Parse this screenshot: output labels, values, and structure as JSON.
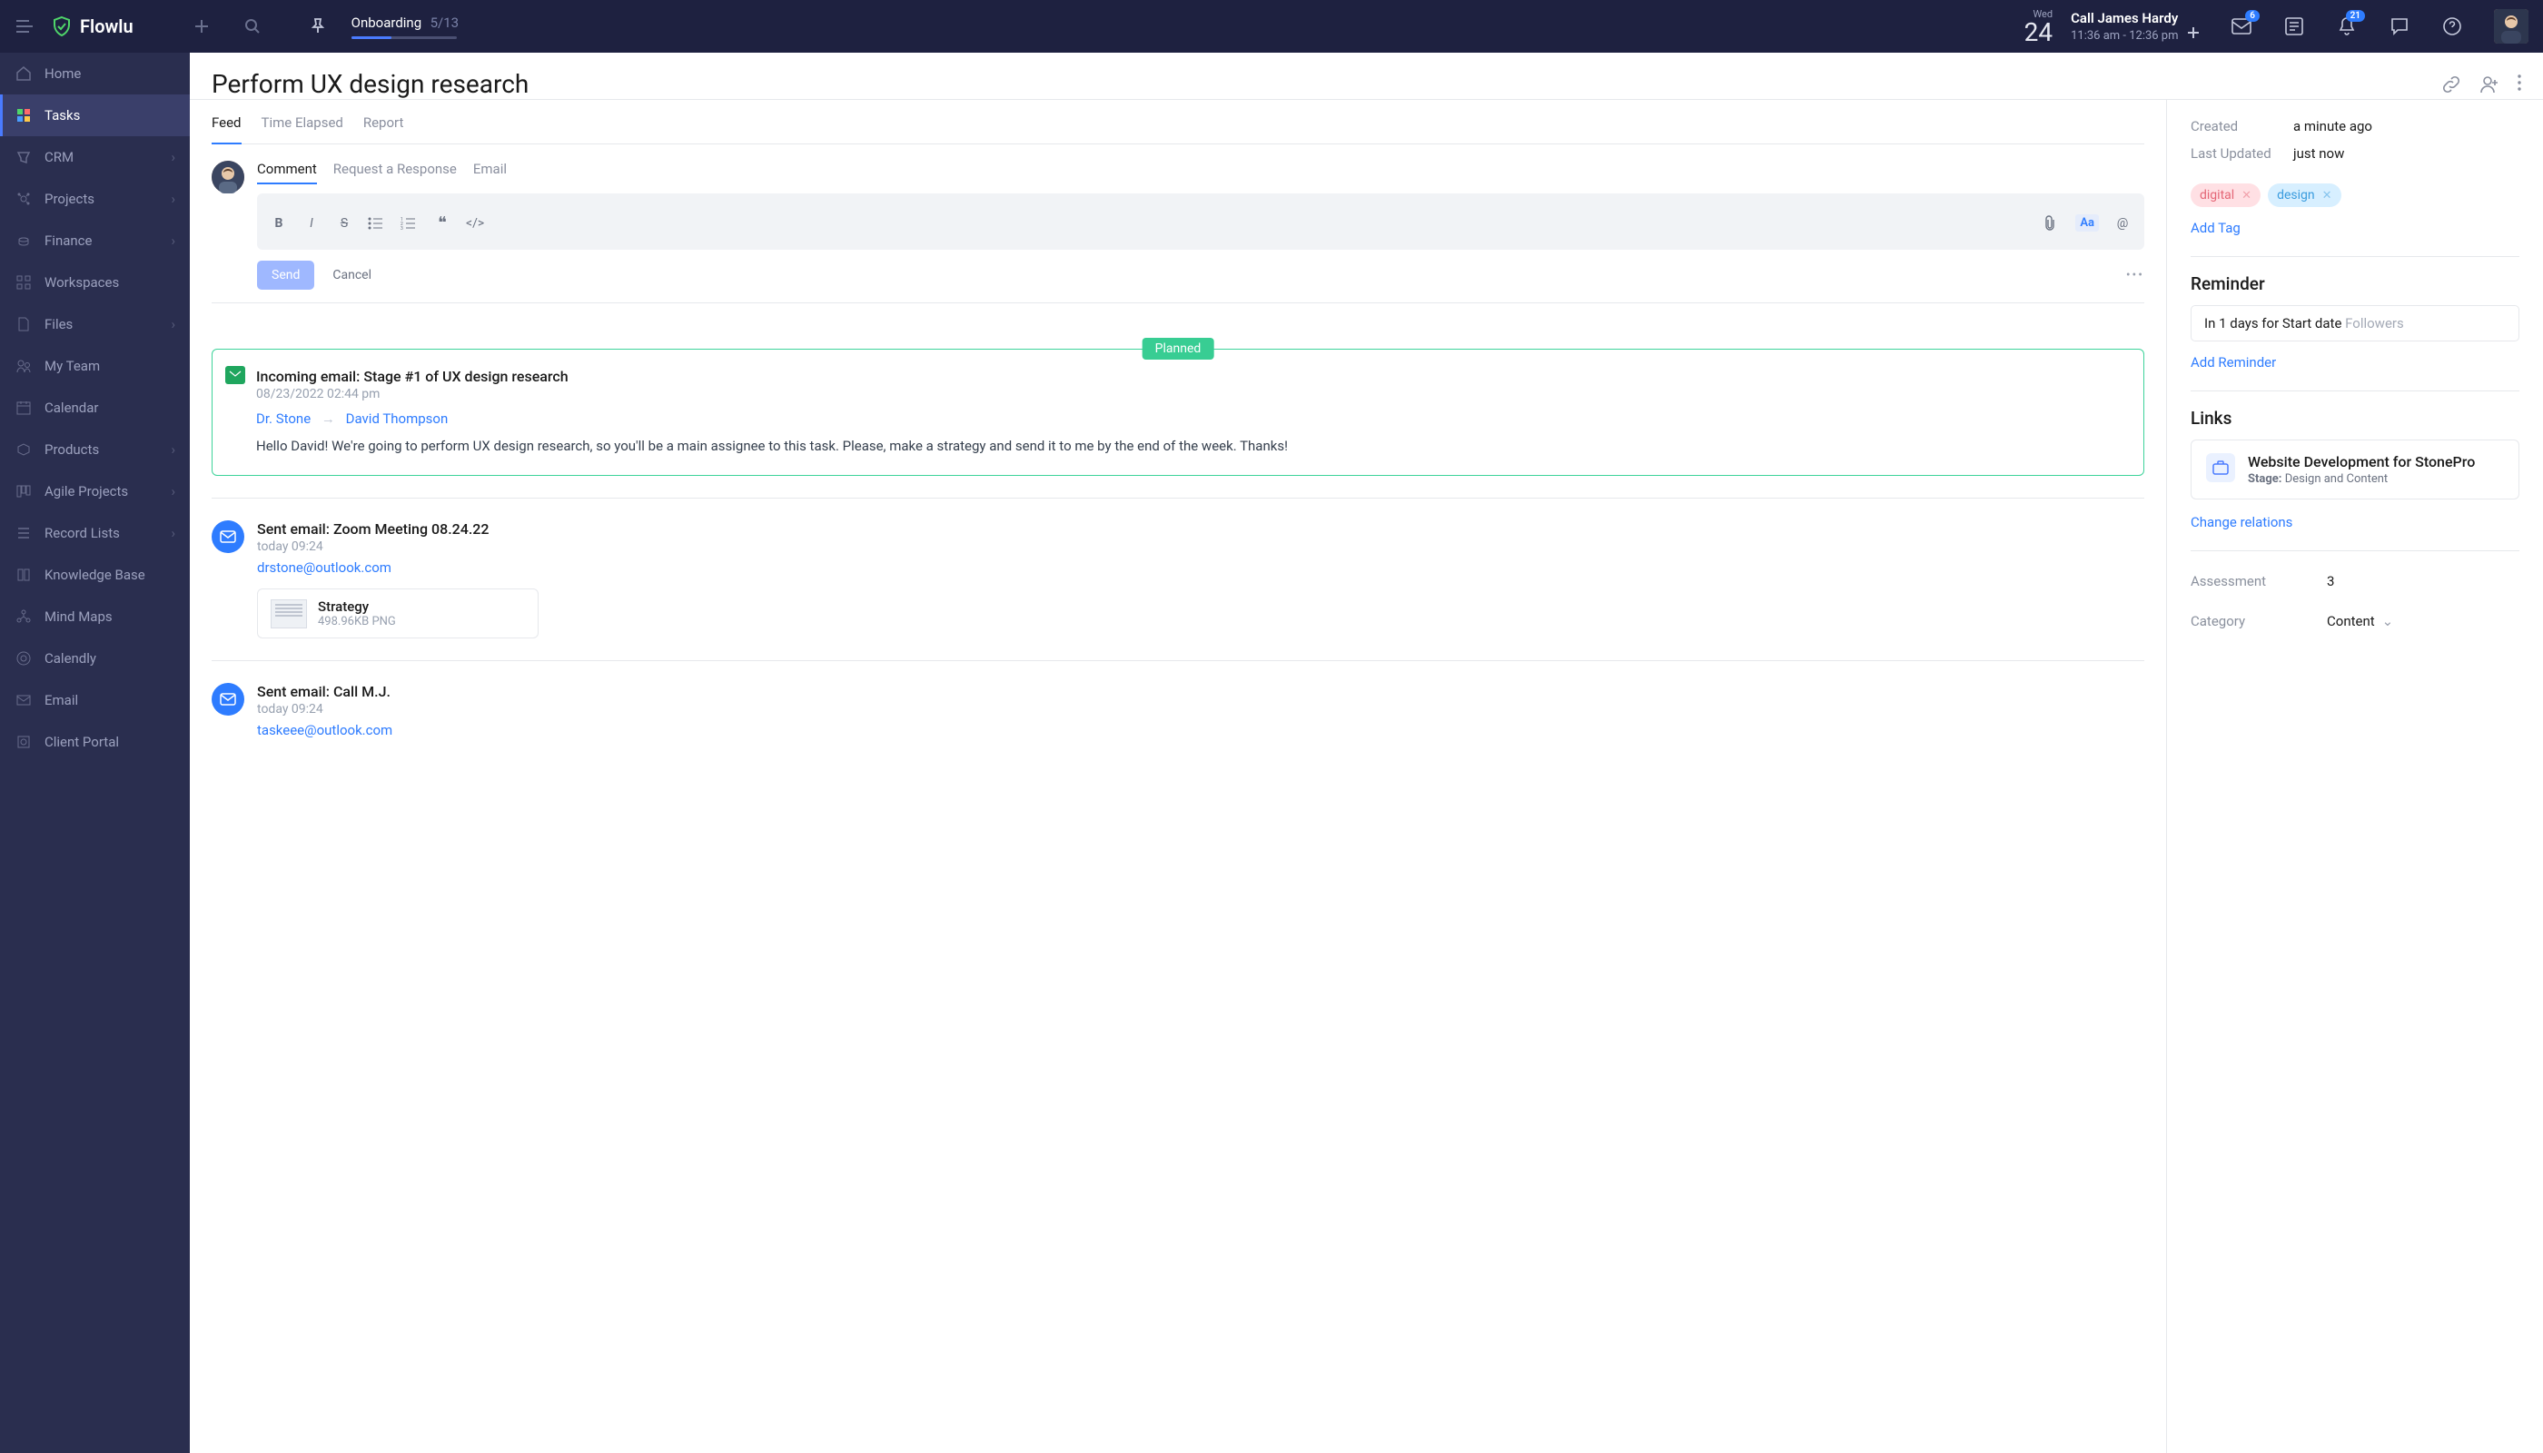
{
  "brand": "Flowlu",
  "onboarding": {
    "label": "Onboarding",
    "count": "5/13",
    "progress_pct": 38
  },
  "top_date": {
    "weekday": "Wed",
    "day": "24"
  },
  "top_event": {
    "title": "Call James Hardy",
    "time": "11:36 am - 12:36 pm"
  },
  "badges": {
    "mail": "6",
    "bell": "21"
  },
  "sidebar": [
    {
      "label": "Home",
      "chev": false
    },
    {
      "label": "Tasks",
      "chev": false
    },
    {
      "label": "CRM",
      "chev": true
    },
    {
      "label": "Projects",
      "chev": true
    },
    {
      "label": "Finance",
      "chev": true
    },
    {
      "label": "Workspaces",
      "chev": false
    },
    {
      "label": "Files",
      "chev": true
    },
    {
      "label": "My Team",
      "chev": false
    },
    {
      "label": "Calendar",
      "chev": false
    },
    {
      "label": "Products",
      "chev": true
    },
    {
      "label": "Agile Projects",
      "chev": true
    },
    {
      "label": "Record Lists",
      "chev": true
    },
    {
      "label": "Knowledge Base",
      "chev": false
    },
    {
      "label": "Mind Maps",
      "chev": false
    },
    {
      "label": "Calendly",
      "chev": false
    },
    {
      "label": "Email",
      "chev": false
    },
    {
      "label": "Client Portal",
      "chev": false
    }
  ],
  "page_title": "Perform UX design research",
  "tabs": [
    "Feed",
    "Time Elapsed",
    "Report"
  ],
  "compose_tabs": [
    "Comment",
    "Request a Response",
    "Email"
  ],
  "buttons": {
    "send": "Send",
    "cancel": "Cancel"
  },
  "feed": {
    "planned_badge": "Planned",
    "card1": {
      "title": "Incoming email: Stage #1 of UX design research",
      "date": "08/23/2022 02:44 pm",
      "from": "Dr. Stone",
      "to": "David Thompson",
      "body": "Hello David! We're going to perform UX design research, so you'll be a main assignee to this task. Please, make a strategy and send it to me by the end of the week. Thanks!"
    },
    "item2": {
      "title": "Sent email: Zoom Meeting 08.24.22",
      "date": "today 09:24",
      "link": "drstone@outlook.com",
      "attachment": {
        "name": "Strategy",
        "meta": "498.96KB PNG"
      }
    },
    "item3": {
      "title": "Sent email: Call M.J.",
      "date": "today 09:24",
      "link": "taskeee@outlook.com"
    }
  },
  "meta": {
    "created_label": "Created",
    "created_value": "a minute ago",
    "updated_label": "Last Updated",
    "updated_value": "just now"
  },
  "tags": [
    {
      "text": "digital",
      "cls": "pink"
    },
    {
      "text": "design",
      "cls": "blue"
    }
  ],
  "right_labels": {
    "add_tag": "Add Tag",
    "reminder_title": "Reminder",
    "reminder_text": "In 1 days for Start date",
    "reminder_followers": "Followers",
    "add_reminder": "Add Reminder",
    "links_title": "Links",
    "link_name": "Website Development for StonePro",
    "link_stage_label": "Stage:",
    "link_stage": "Design and Content",
    "change_relations": "Change relations",
    "assessment_label": "Assessment",
    "assessment_value": "3",
    "category_label": "Category",
    "category_value": "Content"
  }
}
